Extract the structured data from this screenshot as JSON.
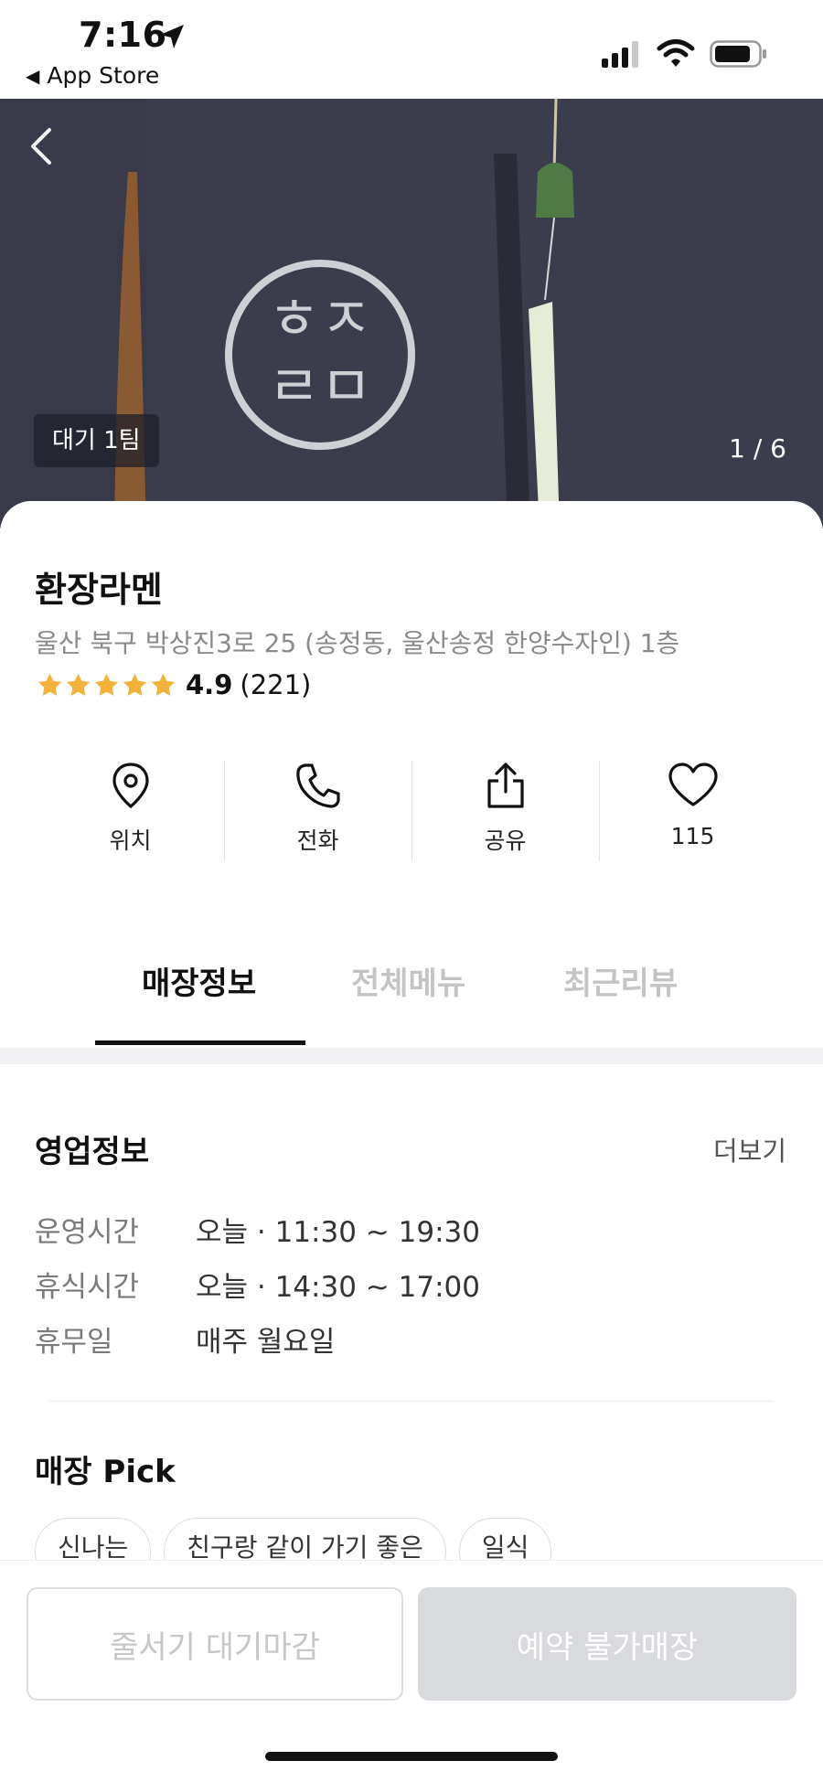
{
  "status_bar": {
    "time": "7:16",
    "back_app": "App Store"
  },
  "hero": {
    "wait_badge": "대기 1팀",
    "counter": "1 / 6",
    "logo_text": "ㅎㅈ\nㄹㅁ"
  },
  "store": {
    "name": "환장라멘",
    "address": "울산 북구 박상진3로 25 (송정동, 울산송정 한양수자인) 1층",
    "rating": "4.9",
    "review_count": "(221)",
    "stars": 5
  },
  "actions": [
    {
      "label": "위치",
      "icon": "location-pin-icon"
    },
    {
      "label": "전화",
      "icon": "phone-icon"
    },
    {
      "label": "공유",
      "icon": "share-icon"
    },
    {
      "label": "115",
      "icon": "heart-icon"
    }
  ],
  "tabs": [
    {
      "label": "매장정보",
      "active": true
    },
    {
      "label": "전체메뉴",
      "active": false
    },
    {
      "label": "최근리뷰",
      "active": false
    }
  ],
  "business_info": {
    "title": "영업정보",
    "more": "더보기",
    "rows": [
      {
        "key": "운영시간",
        "value": "오늘 · 11:30 ~ 19:30"
      },
      {
        "key": "휴식시간",
        "value": "오늘 · 14:30 ~ 17:00"
      },
      {
        "key": "휴무일",
        "value": "매주 월요일"
      }
    ]
  },
  "store_pick": {
    "title": "매장 Pick",
    "chips": [
      "신나는",
      "친구랑 같이 가기 좋은",
      "일식"
    ]
  },
  "bottom_buttons": {
    "queue": "줄서기 대기마감",
    "reserve": "예약 불가매장"
  },
  "colors": {
    "star": "#f5b23b",
    "hero_bg": "#3b3d4d",
    "disabled_btn": "#d9dadd"
  }
}
